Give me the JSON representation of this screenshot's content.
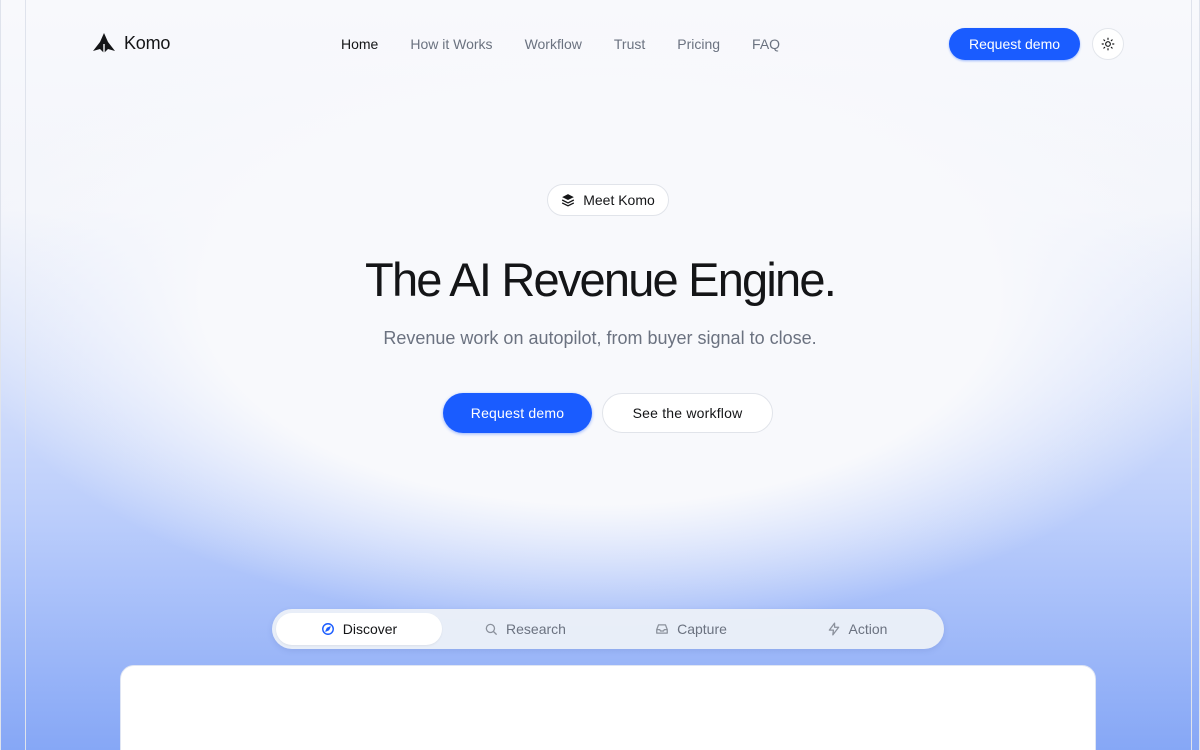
{
  "header": {
    "brand_name": "Komo",
    "nav_items": [
      {
        "label": "Home",
        "active": true
      },
      {
        "label": "How it Works",
        "active": false
      },
      {
        "label": "Workflow",
        "active": false
      },
      {
        "label": "Trust",
        "active": false
      },
      {
        "label": "Pricing",
        "active": false
      },
      {
        "label": "FAQ",
        "active": false
      }
    ],
    "cta_label": "Request demo",
    "theme_toggle_icon": "sun-icon"
  },
  "hero": {
    "badge_label": "Meet Komo",
    "badge_icon": "layers-icon",
    "title": "The AI Revenue Engine.",
    "subtitle": "Revenue work on autopilot, from buyer signal to close.",
    "primary_button": "Request demo",
    "secondary_button": "See the workflow"
  },
  "tabs": [
    {
      "label": "Discover",
      "icon": "discover-icon",
      "active": true
    },
    {
      "label": "Research",
      "icon": "search-icon",
      "active": false
    },
    {
      "label": "Capture",
      "icon": "inbox-icon",
      "active": false
    },
    {
      "label": "Action",
      "icon": "bolt-icon",
      "active": false
    }
  ],
  "colors": {
    "accent": "#1a5cff",
    "text": "#141517",
    "muted": "#6b7280",
    "gradient_bottom": "#86a7f6"
  }
}
